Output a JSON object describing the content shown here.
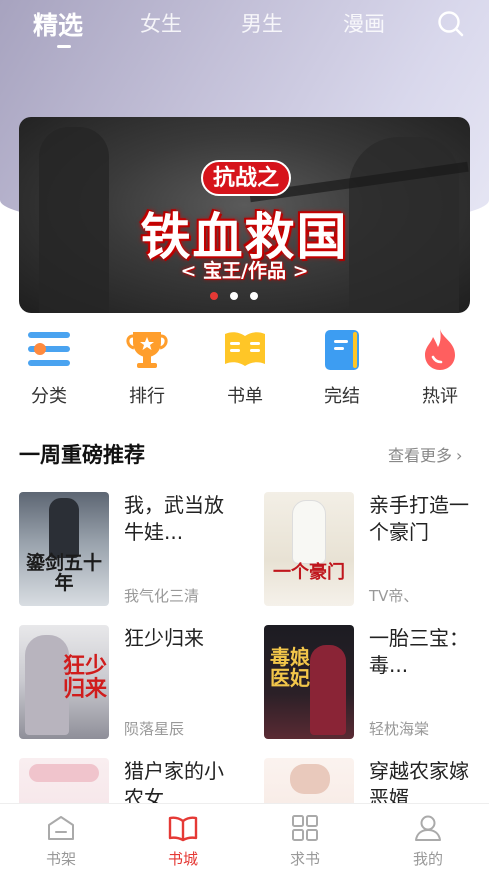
{
  "top_tabs": [
    {
      "label": "精选",
      "active": true
    },
    {
      "label": "女生",
      "active": false
    },
    {
      "label": "男生",
      "active": false
    },
    {
      "label": "漫画",
      "active": false
    }
  ],
  "banner": {
    "tag": "抗战之",
    "title": "铁血救国",
    "author": "< 宝王/作品 >",
    "dots": [
      {
        "active": true
      },
      {
        "active": false
      },
      {
        "active": false
      }
    ]
  },
  "quick_links": [
    {
      "label": "分类",
      "icon": "category-icon"
    },
    {
      "label": "排行",
      "icon": "trophy-icon"
    },
    {
      "label": "书单",
      "icon": "book-list-icon"
    },
    {
      "label": "完结",
      "icon": "finished-book-icon"
    },
    {
      "label": "热评",
      "icon": "flame-icon"
    }
  ],
  "section": {
    "title": "一周重磅推荐",
    "more": "查看更多"
  },
  "books": [
    {
      "title": "我，武当放牛娃...",
      "author": "我气化三清",
      "cover_text": "鎏剑五十年"
    },
    {
      "title": "亲手打造一个豪门",
      "author": "TV帝、",
      "cover_text": "一个豪门"
    },
    {
      "title": "狂少归来",
      "author": "陨落星辰",
      "cover_text": "狂少归来"
    },
    {
      "title": "一胎三宝：毒...",
      "author": "轻枕海棠",
      "cover_text": "毒娘医妃"
    },
    {
      "title": "猎户家的小农女",
      "author": "",
      "cover_text": ""
    },
    {
      "title": "穿越农家嫁恶婿",
      "author": "",
      "cover_text": ""
    }
  ],
  "bottom_nav": [
    {
      "label": "书架",
      "icon": "bookshelf-icon",
      "active": false
    },
    {
      "label": "书城",
      "icon": "bookstore-icon",
      "active": true
    },
    {
      "label": "求书",
      "icon": "grid-icon",
      "active": false
    },
    {
      "label": "我的",
      "icon": "profile-icon",
      "active": false
    }
  ],
  "colors": {
    "accent": "#e53935",
    "header_gradient_start": "#a7a3bf",
    "header_gradient_end": "#e6e6f4"
  }
}
